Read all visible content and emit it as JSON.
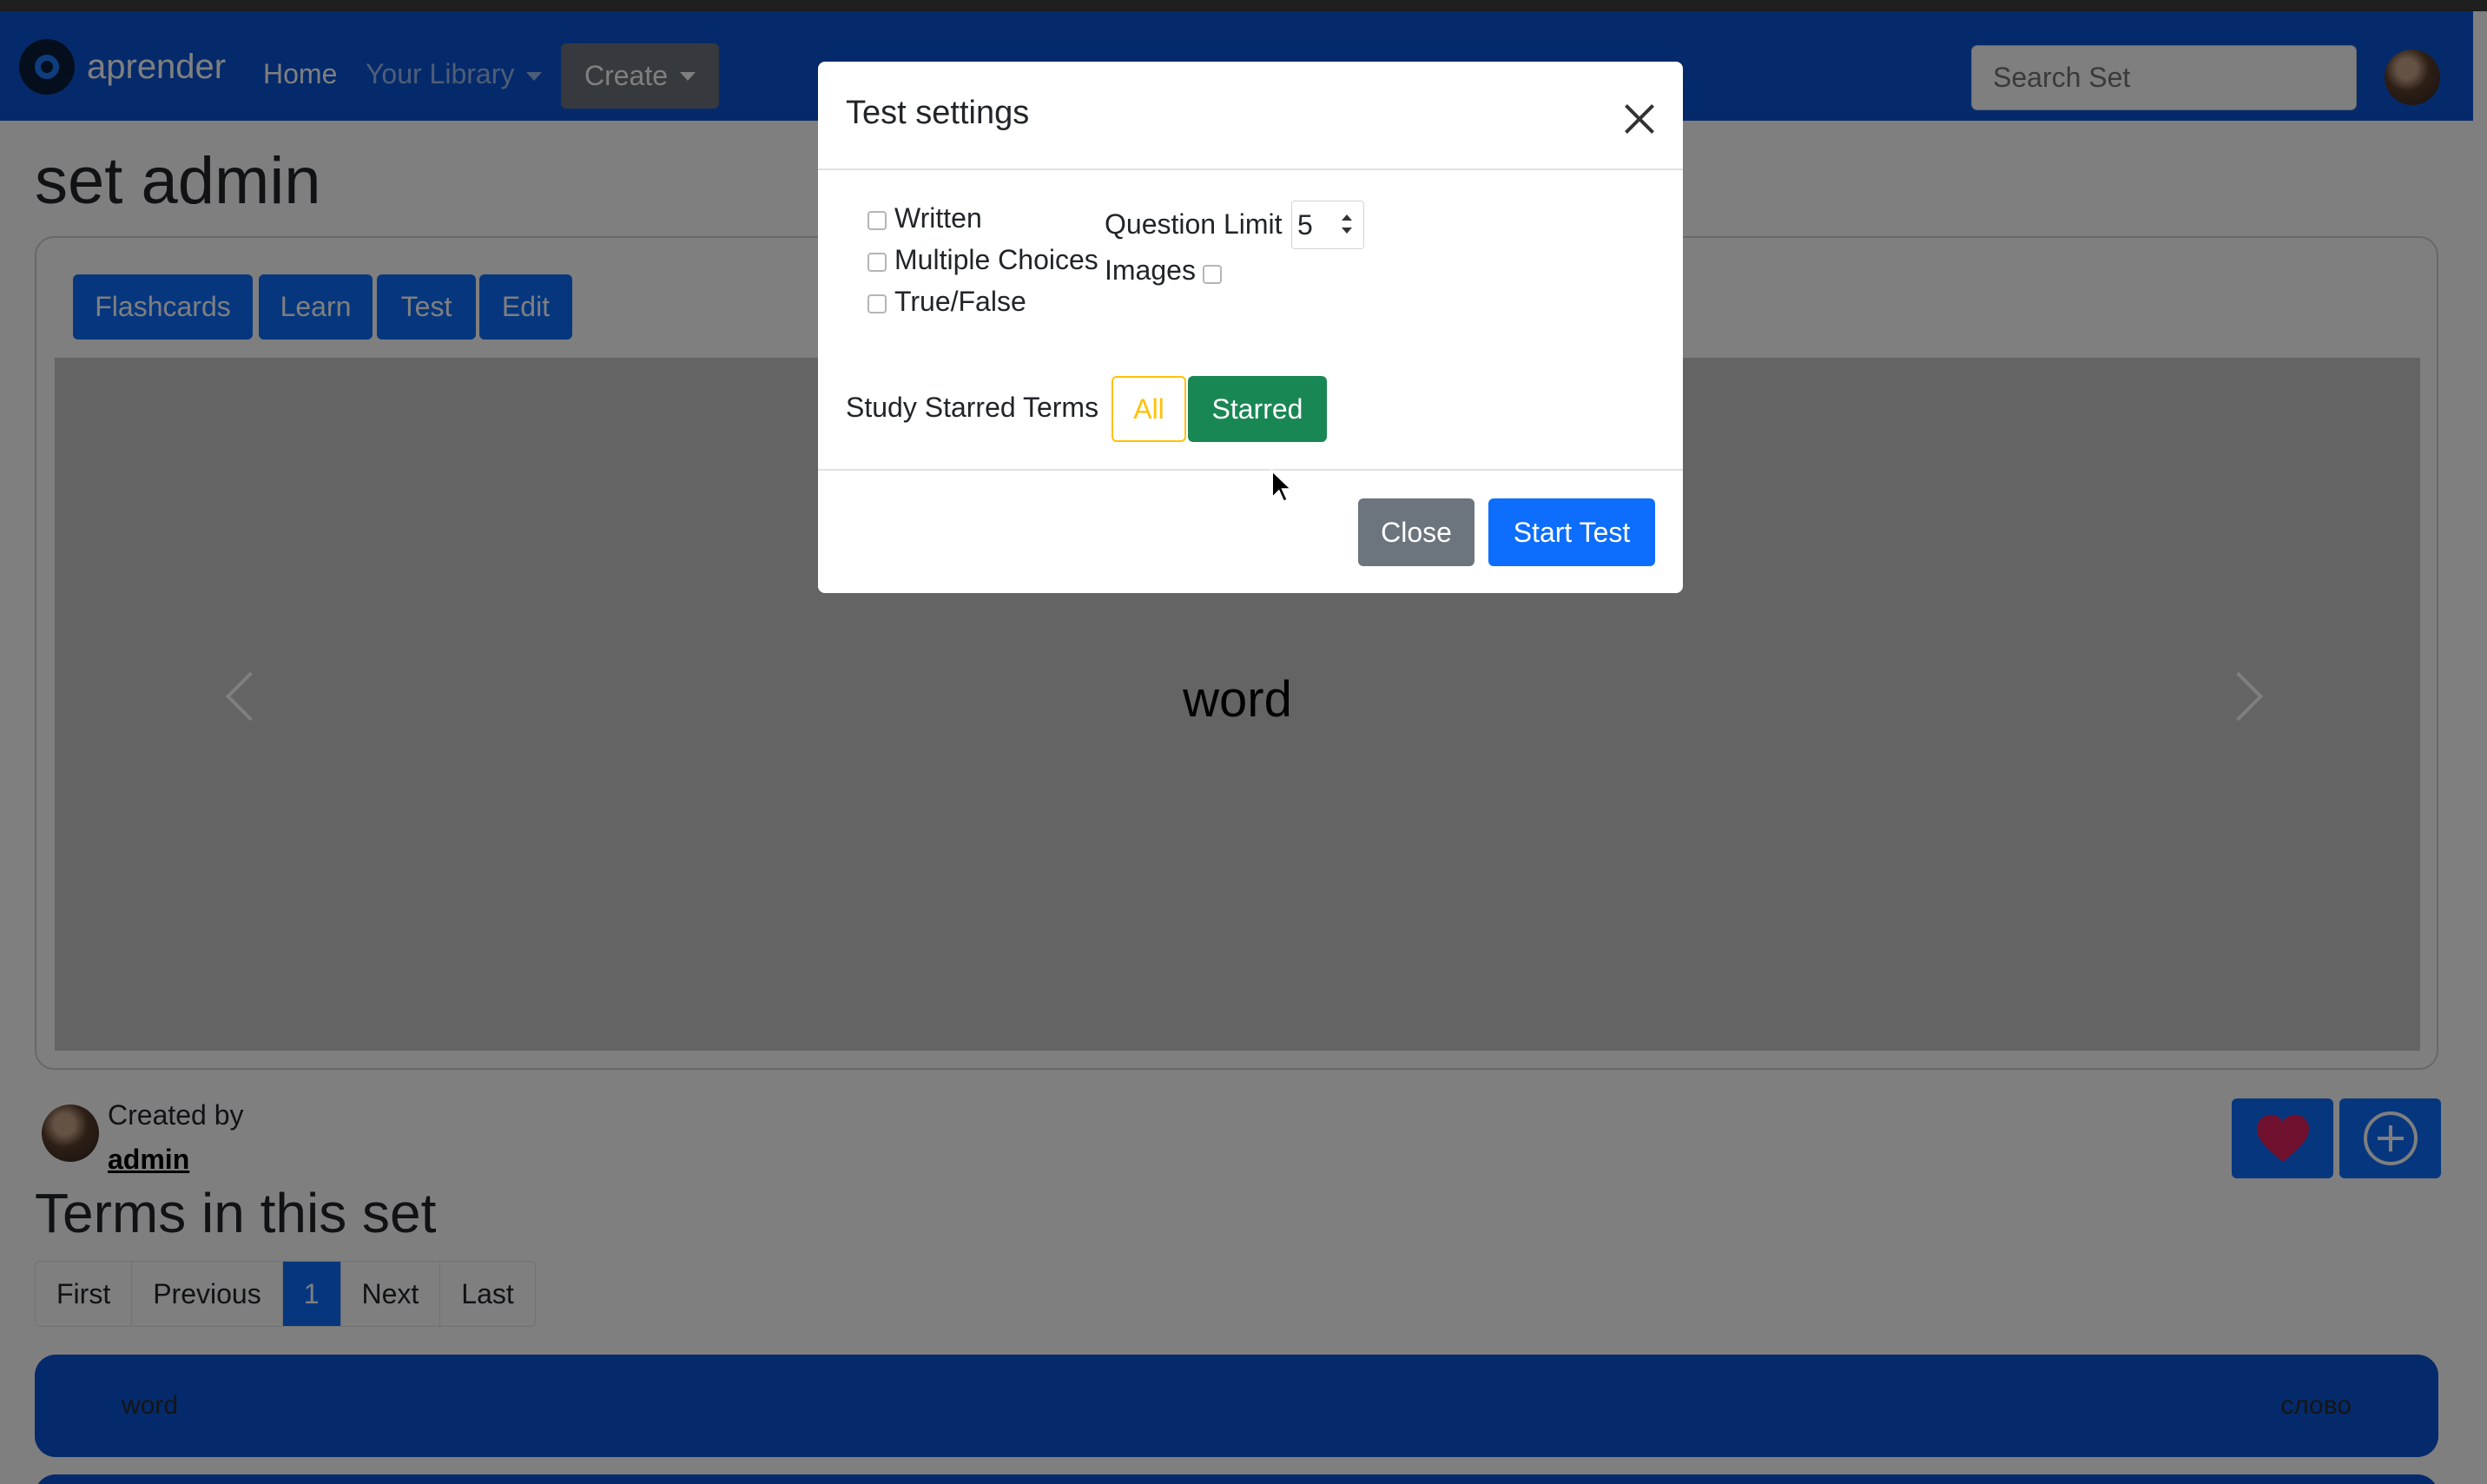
{
  "navbar": {
    "brand": "aprender",
    "links": [
      "Home",
      "Your Library"
    ],
    "create_label": "Create",
    "search_placeholder": "Search Set"
  },
  "page": {
    "title": "set admin",
    "modes": [
      "Flashcards",
      "Learn",
      "Test",
      "Edit"
    ],
    "flashcard_word": "word",
    "created_by_label": "Created by",
    "creator": "admin",
    "terms_title": "Terms in this set",
    "pagination": [
      "First",
      "Previous",
      "1",
      "Next",
      "Last"
    ],
    "terms": [
      {
        "term": "word",
        "definition": "слово"
      }
    ]
  },
  "modal": {
    "title": "Test settings",
    "question_types": [
      "Written",
      "Multiple Choices",
      "True/False"
    ],
    "question_limit_label": "Question Limit",
    "question_limit_value": "5",
    "images_label": "Images",
    "starred_label": "Study Starred Terms",
    "starred_options": [
      "All",
      "Starred"
    ],
    "starred_selected": "Starred",
    "close_label": "Close",
    "start_label": "Start Test"
  },
  "colors": {
    "primary": "#0d6efd",
    "navbar": "#0b55d6",
    "success": "#198754",
    "warning": "#ffc107",
    "secondary": "#6c757d"
  }
}
